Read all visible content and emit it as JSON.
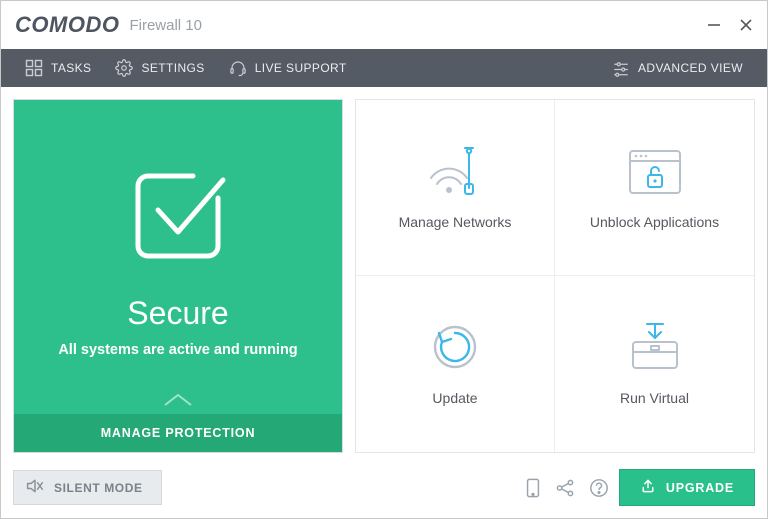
{
  "header": {
    "brand": "COMODO",
    "product": "Firewall 10"
  },
  "toolbar": {
    "tasks": "TASKS",
    "settings": "SETTINGS",
    "live_support": "LIVE SUPPORT",
    "advanced_view": "ADVANCED VIEW"
  },
  "status": {
    "title": "Secure",
    "subtitle": "All systems are active and running",
    "manage_protection": "MANAGE PROTECTION"
  },
  "tiles": {
    "manage_networks": "Manage Networks",
    "unblock_applications": "Unblock Applications",
    "update": "Update",
    "run_virtual": "Run Virtual"
  },
  "bottom": {
    "silent_mode": "SILENT MODE",
    "upgrade": "UPGRADE"
  },
  "colors": {
    "status_panel": "#2dc08d",
    "status_footer": "#24a876",
    "upgrade": "#29c08b",
    "toolbar": "#555b64",
    "icon_blue": "#3bb7e9",
    "icon_neutral": "#b9c2cc"
  }
}
